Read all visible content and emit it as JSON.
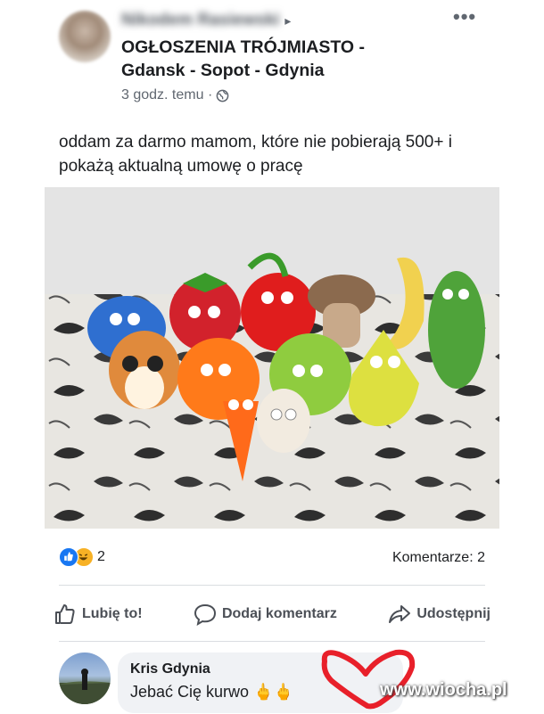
{
  "header": {
    "author_name": "Nikodem Rasiewski",
    "group_title": "OGŁOSZENIA TRÓJMIASTO - Gdansk - Sopot - Gdynia",
    "timestamp": "3 godz. temu ·",
    "more_label": "•••"
  },
  "post": {
    "text": "oddam za darmo mamom, które nie pobierają 500+ i pokażą aktualną umowę o pracę"
  },
  "stats": {
    "reaction_count": "2",
    "comment_count": "Komentarze: 2"
  },
  "actions": {
    "like": "Lubię to!",
    "comment": "Dodaj komentarz",
    "share": "Udostępnij"
  },
  "comment": {
    "author": "Kris Gdynia",
    "text": "Jebać Cię kurwo 🖕🖕"
  },
  "watermark": "www.wiocha.pl",
  "colors": {
    "like_blue": "#1877f2",
    "text_primary": "#1c1e21",
    "text_secondary": "#606770",
    "heart_red": "#e8202a"
  }
}
